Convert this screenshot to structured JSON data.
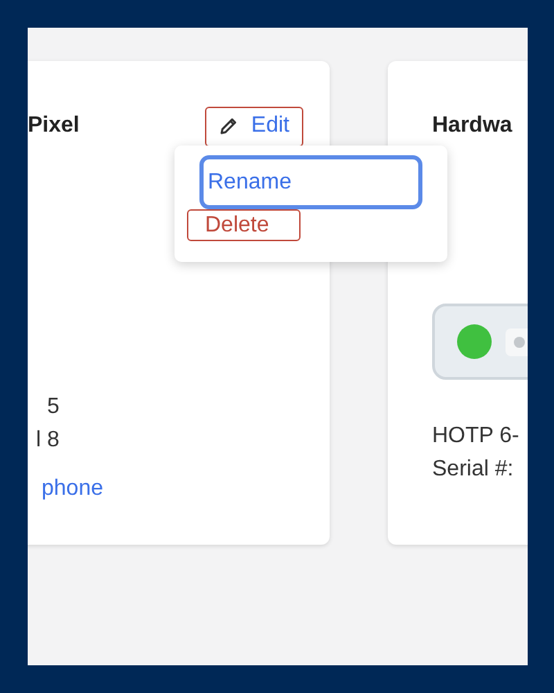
{
  "cards": [
    {
      "title": "Pixel",
      "edit_button": {
        "label": "Edit"
      },
      "menu": {
        "items": [
          {
            "label": "Rename",
            "kind": "normal",
            "focused": true
          },
          {
            "label": "Delete",
            "kind": "danger",
            "focused": false
          }
        ]
      },
      "details": [
        "5",
        "l 8"
      ],
      "link": "phone"
    },
    {
      "title": "Hardwa",
      "status": {
        "on": true
      },
      "details": [
        "HOTP 6-",
        "Serial #:"
      ]
    }
  ]
}
